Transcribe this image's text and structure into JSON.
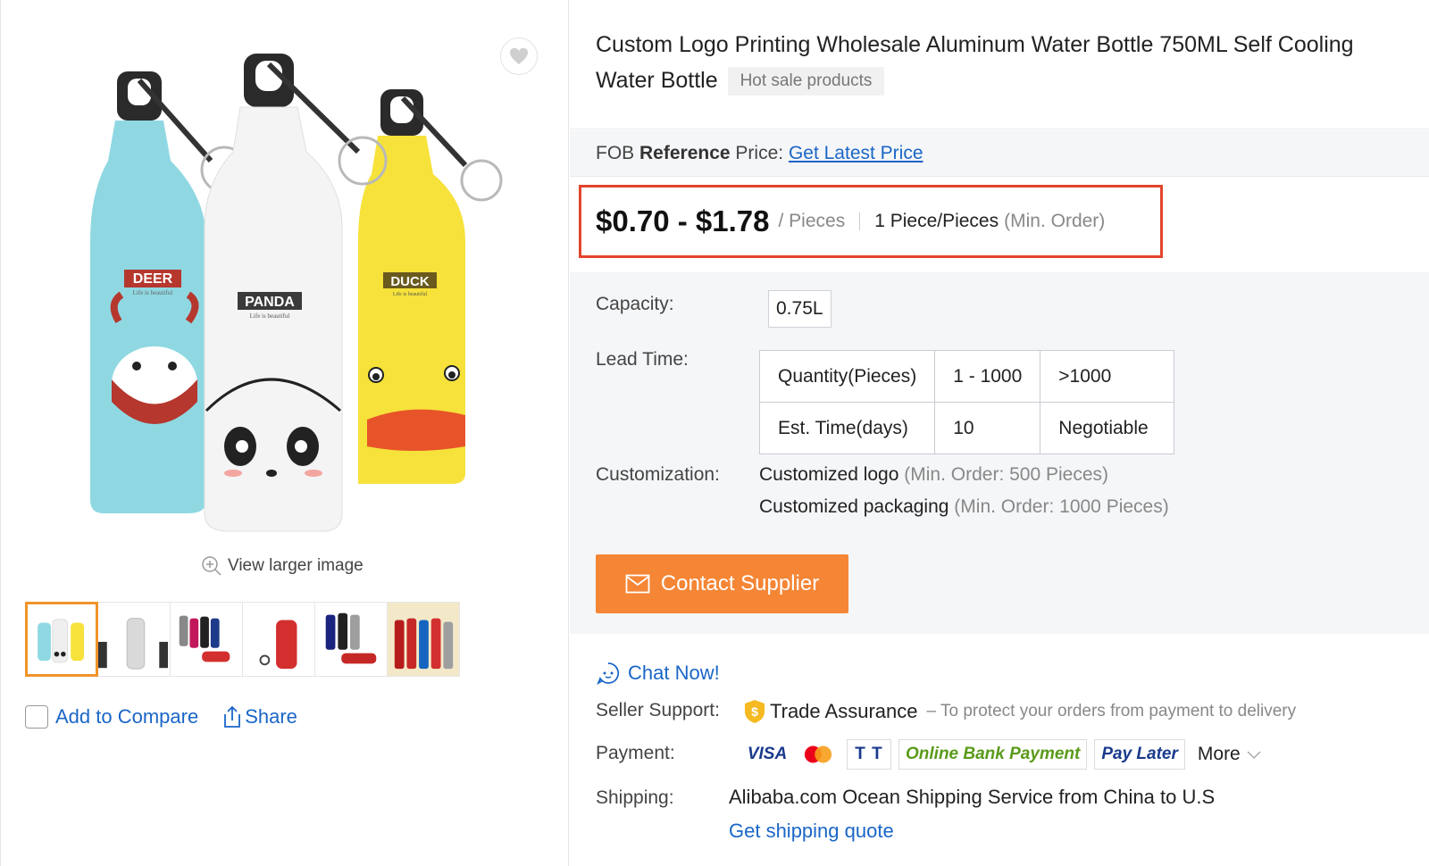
{
  "product": {
    "title": "Custom Logo Printing Wholesale Aluminum Water Bottle 750ML Self Cooling Water Bottle",
    "tag": "Hot sale products"
  },
  "gallery": {
    "bottle_labels": [
      "DEER",
      "PANDA",
      "DUCK"
    ],
    "bottle_taglines": [
      "Life is beautiful",
      "Life is beautiful",
      "Life is beautiful"
    ],
    "view_larger": "View larger image",
    "thumbnails": [
      "thumb-1",
      "thumb-2",
      "thumb-3",
      "thumb-4",
      "thumb-5",
      "thumb-6"
    ],
    "active_thumbnail": 1,
    "add_to_compare": "Add to Compare",
    "share": "Share"
  },
  "pricing": {
    "fob_prefix": "FOB ",
    "fob_bold": "Reference",
    "fob_suffix": " Price:",
    "latest_price_link": "Get Latest Price",
    "price_range": "$0.70 - $1.78",
    "unit": "/ Pieces",
    "min_order_qty": "1 Piece/Pieces",
    "min_order_note": "(Min. Order)"
  },
  "specs": {
    "capacity_label": "Capacity:",
    "capacity_value": "0.75L",
    "lead_time_label": "Lead Time:",
    "lead_time_table": [
      [
        "Quantity(Pieces)",
        "1 - 1000",
        ">1000"
      ],
      [
        "Est. Time(days)",
        "10",
        "Negotiable"
      ]
    ],
    "customization_label": "Customization:",
    "customizations": [
      {
        "name": "Customized logo",
        "note": "(Min. Order: 500 Pieces)"
      },
      {
        "name": "Customized packaging",
        "note": "(Min. Order: 1000 Pieces)"
      }
    ],
    "contact_button": "Contact Supplier"
  },
  "seller": {
    "chat_now": "Chat Now!",
    "support_label": "Seller Support:",
    "trade_assurance": "Trade Assurance",
    "trade_assurance_note": "– To protect your orders from payment to delivery",
    "payment_label": "Payment:",
    "payment_methods": [
      "VISA",
      "",
      "T T",
      "Online Bank Payment",
      "Pay Later"
    ],
    "more": "More",
    "shipping_label": "Shipping:",
    "shipping_text": "Alibaba.com Ocean Shipping Service from China to U.S",
    "shipping_quote": "Get shipping quote"
  },
  "colors": {
    "accent": "#f58636",
    "link": "#1a66c7",
    "highlight_border": "#e2452d",
    "active_thumb": "#f0932b"
  }
}
